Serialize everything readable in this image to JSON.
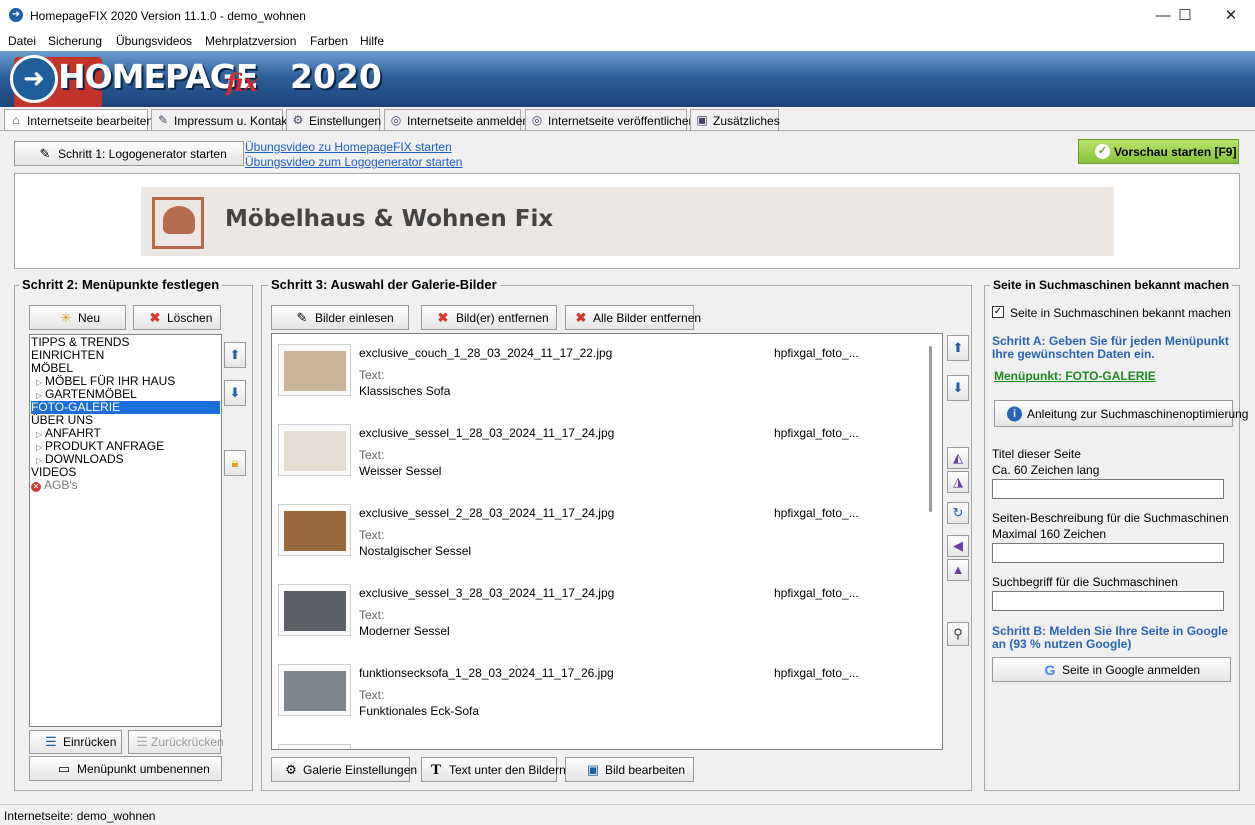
{
  "window": {
    "title": "HomepageFIX 2020 Version 11.1.0 - demo_wohnen",
    "minimize": "—",
    "maximize": "☐",
    "close": "✕"
  },
  "menu": {
    "items": [
      "Datei",
      "Sicherung",
      "Übungsvideos",
      "Mehrplatzversion",
      "Farben",
      "Hilfe"
    ]
  },
  "banner": {
    "word": "HOMEPAGE",
    "fix": "fix",
    "year": "2020"
  },
  "tabs": [
    {
      "label": "Internetseite bearbeiten",
      "icon": "home-icon"
    },
    {
      "label": "Impressum u. Kontakt",
      "icon": "pencil-icon"
    },
    {
      "label": "Einstellungen",
      "icon": "gear-icon"
    },
    {
      "label": "Internetseite anmelden",
      "icon": "globe-icon"
    },
    {
      "label": "Internetseite veröffentlichen",
      "icon": "globe-icon"
    },
    {
      "label": "Zusätzliches",
      "icon": "image-icon"
    }
  ],
  "step1": {
    "button": "Schritt 1: Logogenerator starten",
    "link1": "Übungsvideo zu HomepageFIX starten",
    "link2": "Übungsvideo zum Logogenerator starten",
    "preview": "Vorschau starten [F9]"
  },
  "logo": {
    "name": "Möbelhaus & Wohnen Fix"
  },
  "step2": {
    "heading": "Schritt 2: Menüpunkte festlegen",
    "new": "Neu",
    "delete": "Löschen",
    "indent": "Einrücken",
    "outdent": "Zurückrücken",
    "rename": "Menüpunkt umbenennen",
    "items": [
      {
        "label": "TIPPS & TRENDS",
        "level": 0
      },
      {
        "label": "EINRICHTEN",
        "level": 0
      },
      {
        "label": "MÖBEL",
        "level": 0
      },
      {
        "label": "MÖBEL FÜR IHR HAUS",
        "level": 1
      },
      {
        "label": "GARTENMÖBEL",
        "level": 1
      },
      {
        "label": "FOTO-GALERIE",
        "level": 0,
        "selected": true
      },
      {
        "label": "ÜBER UNS",
        "level": 0
      },
      {
        "label": "ANFAHRT",
        "level": 1
      },
      {
        "label": "PRODUKT ANFRAGE",
        "level": 1
      },
      {
        "label": "DOWNLOADS",
        "level": 1
      },
      {
        "label": "VIDEOS",
        "level": 0
      },
      {
        "label": "AGB's",
        "level": 0,
        "disabled": true
      }
    ]
  },
  "step3": {
    "heading": "Schritt 3: Auswahl der Galerie-Bilder",
    "load": "Bilder einlesen",
    "remove": "Bild(er) entfernen",
    "remove_all": "Alle Bilder entfernen",
    "settings": "Galerie Einstellungen",
    "text_under": "Text unter den Bildern",
    "edit_image": "Bild bearbeiten",
    "text_label": "Text:",
    "images": [
      {
        "file": "exclusive_couch_1_28_03_2024_11_17_22.jpg",
        "text": "Klassisches Sofa",
        "gallery": "hpfixgal_foto_...",
        "color": "#c9b39a"
      },
      {
        "file": "exclusive_sessel_1_28_03_2024_11_17_24.jpg",
        "text": "Weisser Sessel",
        "gallery": "hpfixgal_foto_...",
        "color": "#e3ddd2"
      },
      {
        "file": "exclusive_sessel_2_28_03_2024_11_17_24.jpg",
        "text": "Nostalgischer Sessel",
        "gallery": "hpfixgal_foto_...",
        "color": "#9a6a3f"
      },
      {
        "file": "exclusive_sessel_3_28_03_2024_11_17_24.jpg",
        "text": "Moderner Sessel",
        "gallery": "hpfixgal_foto_...",
        "color": "#5c6068"
      },
      {
        "file": "funktionsecksofa_1_28_03_2024_11_17_26.jpg",
        "text": "Funktionales Eck-Sofa",
        "gallery": "hpfixgal_foto_...",
        "color": "#7f858d"
      }
    ]
  },
  "seo": {
    "heading": "Seite in Suchmaschinen bekannt machen",
    "checkbox": "Seite in Suchmaschinen bekannt machen",
    "checked": true,
    "step_a": "Schritt A: Geben Sie für jeden Menüpunkt Ihre gewünschten Daten ein.",
    "menu_point": "Menüpunkt: FOTO-GALERIE",
    "guide": "Anleitung zur Suchmaschinenoptimierung",
    "title_label": "Titel dieser Seite",
    "title_hint": "Ca. 60 Zeichen lang",
    "desc_label": "Seiten-Beschreibung für die Suchmaschinen",
    "desc_hint": "Maximal 160 Zeichen",
    "keyword_label": "Suchbegriff für die Suchmaschinen",
    "step_b": "Schritt B: Melden Sie Ihre Seite in Google an (93 % nutzen Google)",
    "google": "Seite in Google anmelden"
  },
  "status": {
    "text": "Internetseite: demo_wohnen"
  },
  "colors": {
    "accent_blue": "#2a64b6",
    "selection": "#1a6fd8",
    "preview_green": "#86c23a"
  }
}
